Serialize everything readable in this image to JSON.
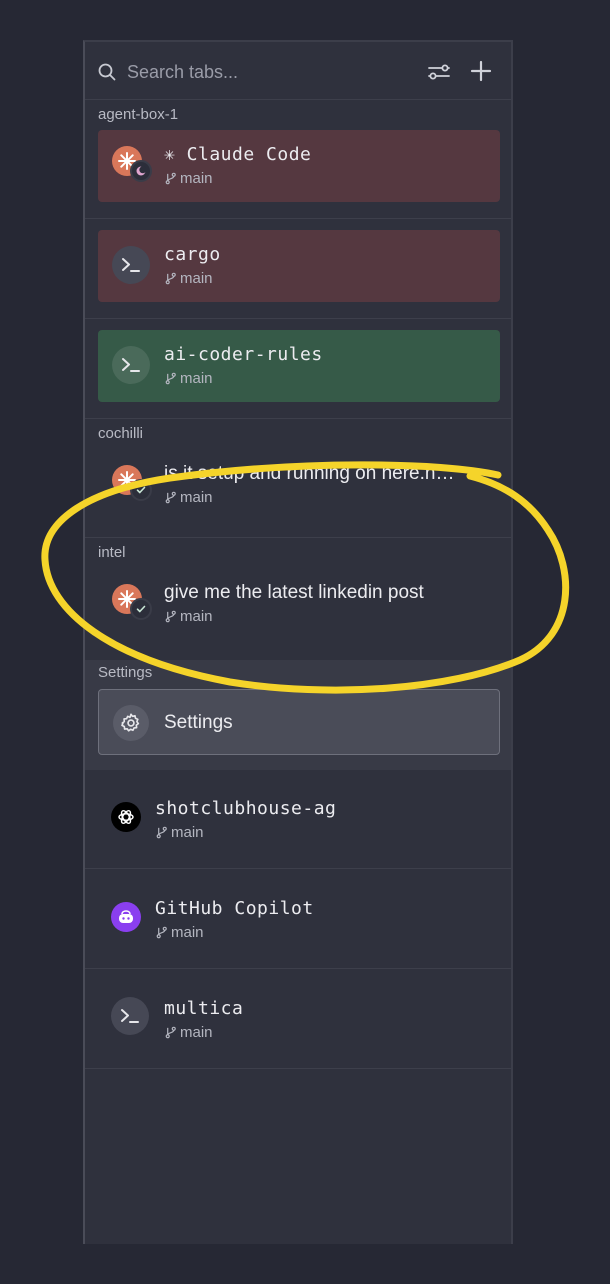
{
  "search": {
    "placeholder": "Search tabs..."
  },
  "groups": {
    "agent_box": "agent-box-1",
    "cochilli": "cochilli",
    "intel": "intel",
    "settings": "Settings"
  },
  "tabs": [
    {
      "title": "✳ Claude Code",
      "branch": "main",
      "icon": "claude-icon",
      "status": "moon-status-icon",
      "color": "#553840"
    },
    {
      "title": "cargo",
      "branch": "main",
      "icon": "terminal-icon",
      "color": "#553840"
    },
    {
      "title": "ai-coder-rules",
      "branch": "main",
      "icon": "terminal-icon",
      "color": "#365a48"
    },
    {
      "title": "is it setup and running on here.now?",
      "branch": "main",
      "icon": "claude-icon",
      "status": "check-icon"
    },
    {
      "title": "give me the latest linkedin post",
      "branch": "main",
      "icon": "claude-icon",
      "status": "check-icon"
    }
  ],
  "settings_button": {
    "label": "Settings",
    "icon": "gear-icon"
  },
  "rows": [
    {
      "title": "shotclubhouse-ag",
      "branch": "main",
      "icon": "openai-icon"
    },
    {
      "title": "GitHub Copilot",
      "branch": "main",
      "icon": "copilot-icon",
      "color": "#8a3ff0"
    },
    {
      "title": "multica",
      "branch": "main",
      "icon": "terminal-icon"
    }
  ],
  "annotation_color": "#f5d42a"
}
